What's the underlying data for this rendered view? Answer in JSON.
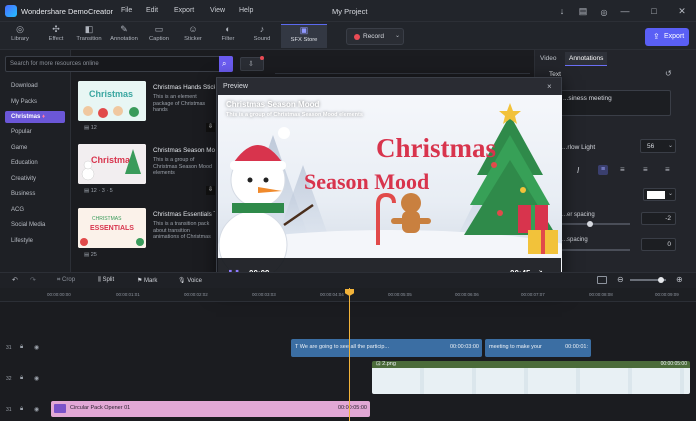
{
  "app": {
    "title": "Wondershare DemoCreator",
    "project": "My Project"
  },
  "menu": [
    "File",
    "Edit",
    "Export",
    "View",
    "Help"
  ],
  "window_controls": [
    "↓",
    "▤",
    "—",
    "□",
    "✕"
  ],
  "toolbar": {
    "tools": [
      "Library",
      "Effect",
      "Transition",
      "Annotation",
      "Caption",
      "Sticker",
      "Filter",
      "Sound",
      "SFX Store"
    ],
    "record_label": "Record",
    "export_label": "Export"
  },
  "search": {
    "placeholder": "Search for more resources online"
  },
  "categories": [
    "Download",
    "My Packs",
    "Christmas",
    "Popular",
    "Game",
    "Education",
    "Creativity",
    "Business",
    "ACG",
    "Social Media",
    "Lifestyle"
  ],
  "cards": [
    {
      "title": "Christmas Hands Sticker",
      "desc": "This is an element package of Christmas hands",
      "meta": "12"
    },
    {
      "title": "Christmas Season Mood",
      "desc": "This is a group of Christmas Season Mood elements",
      "meta": "12 · 3 · 5"
    },
    {
      "title": "Christmas Essentials Tr...",
      "desc": "This is a transition pack about transition animations of Christmas",
      "meta": "25"
    }
  ],
  "right_panel": {
    "tabs": [
      "Video",
      "Annotations"
    ],
    "section": "Text",
    "text_value": "...siness meeting",
    "font": "...rlow Light",
    "font_size": "56",
    "letter_spacing_label": "...er spacing",
    "letter_spacing": "-2",
    "line_spacing_label": "...spacing",
    "line_spacing": "0"
  },
  "preview": {
    "header": "Preview",
    "title": "Christmas Season Mood",
    "subtitle": "This is a group of Christmas Season Mood elements",
    "art_line1": "Christmas",
    "art_line2": "Season Mood",
    "time_current": "00:09",
    "time_total": "00:45",
    "progress": 0.2
  },
  "timeline_toolbar": {
    "items": [
      "Crop",
      "Split",
      "Mark",
      "Voice"
    ]
  },
  "ruler": [
    "00:00:00:00",
    "00:00:01:01",
    "00:00:02:02",
    "00:00:03:03",
    "00:00:04:04",
    "00:00:05:05",
    "00:00:06:06",
    "00:00:07:07",
    "00:00:08:08",
    "00:00:09:09"
  ],
  "tracks": [
    {
      "num": "31",
      "clips": [
        {
          "label": "We are going to see all the particip...",
          "time": "00:00:03:00"
        },
        {
          "label": "meeting to make your",
          "time": "00:00:01:"
        }
      ]
    },
    {
      "num": "32",
      "clips": [
        {
          "label": "2.png",
          "time": "00:00:05:00"
        }
      ]
    },
    {
      "num": "31",
      "clips": [
        {
          "label": "Circular Pack Opener 01",
          "time": "00:00:05:00"
        }
      ]
    }
  ]
}
